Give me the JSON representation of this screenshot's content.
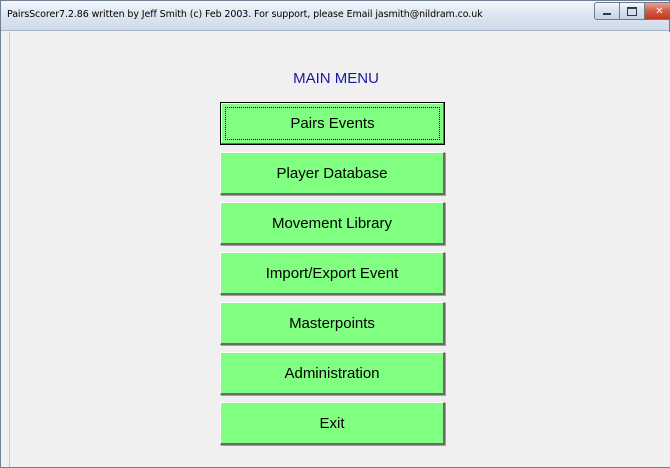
{
  "window": {
    "title": "PairsScorer7.2.86 written by Jeff Smith (c) Feb 2003.  For support, please Email jasmith@nildram.co.uk"
  },
  "icons": {
    "minimize": "minimize-icon",
    "maximize": "maximize-icon",
    "close": "close-icon"
  },
  "main_menu": {
    "title": "MAIN MENU",
    "buttons": [
      {
        "label": "Pairs Events"
      },
      {
        "label": "Player Database"
      },
      {
        "label": "Movement Library"
      },
      {
        "label": "Import/Export Event"
      },
      {
        "label": "Masterpoints"
      },
      {
        "label": "Administration"
      },
      {
        "label": "Exit"
      }
    ]
  },
  "colors": {
    "button_background": "#80ff80",
    "title_color": "#1a1a9c",
    "client_background": "#f0f0f0",
    "close_button": "#c0391f"
  }
}
